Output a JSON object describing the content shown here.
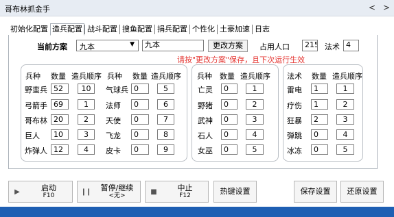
{
  "app": {
    "title": "哥布林抓金手",
    "nav_prev": "<",
    "nav_next": ">"
  },
  "tabs": [
    "初始化配置",
    "造兵配置",
    "战斗配置",
    "搜鱼配置",
    "捐兵配置",
    "个性化",
    "土豪加速",
    "日志"
  ],
  "active_tab": "造兵配置",
  "config": {
    "plan_label": "当前方案",
    "plan_selected": "九本",
    "plan_name": "九本",
    "change_plan_button": "更改方案",
    "population_label": "占用人口",
    "population_value": "215",
    "spell_label": "法术",
    "spell_value": "4",
    "warning": "请按\"更改方案\"保存，且下次运行生效"
  },
  "headers": {
    "troop": "兵种",
    "qty": "数量",
    "order": "造兵顺序",
    "spell": "法术"
  },
  "troops_left": [
    {
      "name": "野蛮兵",
      "qty": "52",
      "order": "10"
    },
    {
      "name": "弓箭手",
      "qty": "69",
      "order": "1"
    },
    {
      "name": "哥布林",
      "qty": "20",
      "order": "2"
    },
    {
      "name": "巨人",
      "qty": "10",
      "order": "3"
    },
    {
      "name": "炸弹人",
      "qty": "12",
      "order": "4"
    }
  ],
  "troops_mid": [
    {
      "name": "气球兵",
      "qty": "0",
      "order": "5"
    },
    {
      "name": "法师",
      "qty": "0",
      "order": "6"
    },
    {
      "name": "天使",
      "qty": "0",
      "order": "7"
    },
    {
      "name": "飞龙",
      "qty": "0",
      "order": "8"
    },
    {
      "name": "皮卡",
      "qty": "0",
      "order": "9"
    }
  ],
  "troops_dark": [
    {
      "name": "亡灵",
      "qty": "0",
      "order": "1"
    },
    {
      "name": "野猪",
      "qty": "0",
      "order": "2"
    },
    {
      "name": "武神",
      "qty": "0",
      "order": "3"
    },
    {
      "name": "石人",
      "qty": "0",
      "order": "4"
    },
    {
      "name": "女巫",
      "qty": "0",
      "order": "5"
    }
  ],
  "spells": [
    {
      "name": "雷电",
      "qty": "1",
      "order": "1"
    },
    {
      "name": "疗伤",
      "qty": "1",
      "order": "2"
    },
    {
      "name": "狂暴",
      "qty": "2",
      "order": "3"
    },
    {
      "name": "弹跳",
      "qty": "0",
      "order": "4"
    },
    {
      "name": "冰冻",
      "qty": "0",
      "order": "5"
    }
  ],
  "controls": {
    "start": {
      "label": "启动",
      "hotkey": "F10",
      "icon": "play-icon"
    },
    "pause": {
      "label": "暂停/继续",
      "hotkey": "<无>",
      "icon": "pause-icon"
    },
    "stop": {
      "label": "中止",
      "hotkey": "F12",
      "icon": "stop-icon"
    },
    "hotkey_settings": "热键设置",
    "save_settings": "保存设置",
    "restore_settings": "还原设置"
  },
  "colors": {
    "warning": "#e53935",
    "taskbar": "#1e5fb3"
  }
}
